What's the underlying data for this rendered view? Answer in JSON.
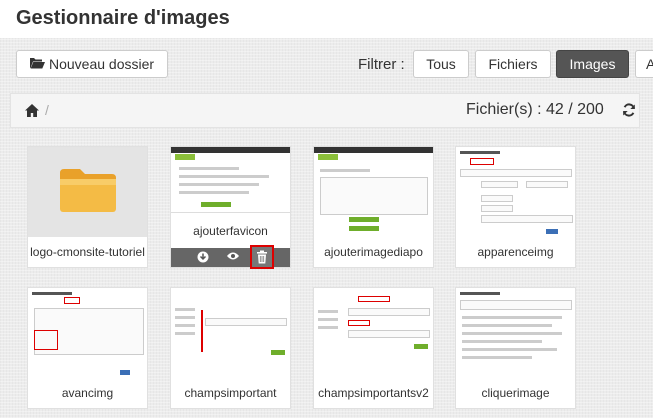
{
  "header": {
    "title": "Gestionnaire d'images"
  },
  "toolbar": {
    "new_folder_label": "Nouveau dossier",
    "filter_label": "Filtrer :",
    "filters": [
      "Tous",
      "Fichiers",
      "Images",
      "A"
    ],
    "active_filter": "Images"
  },
  "breadcrumb": {
    "separator": "/"
  },
  "files": {
    "count_text": "Fichier(s) : 42 / 200"
  },
  "items": [
    {
      "name": "logo-cmonsite-tutoriel",
      "type": "folder-image"
    },
    {
      "name": "ajouterfavicon",
      "type": "image",
      "hovered": true
    },
    {
      "name": "ajouterimagediapo",
      "type": "image"
    },
    {
      "name": "apparenceimg",
      "type": "image"
    },
    {
      "name": "avancimg",
      "type": "image"
    },
    {
      "name": "champsimportant",
      "type": "image"
    },
    {
      "name": "champsimportantsv2",
      "type": "image"
    },
    {
      "name": "cliquerimage",
      "type": "image"
    }
  ],
  "colors": {
    "active_filter_bg": "#555555",
    "delete_highlight": "#dd0000",
    "folder": "#f2b63c"
  },
  "icons": [
    "folder-open-icon",
    "home-icon",
    "refresh-icon",
    "download-icon",
    "eye-icon",
    "trash-icon"
  ]
}
